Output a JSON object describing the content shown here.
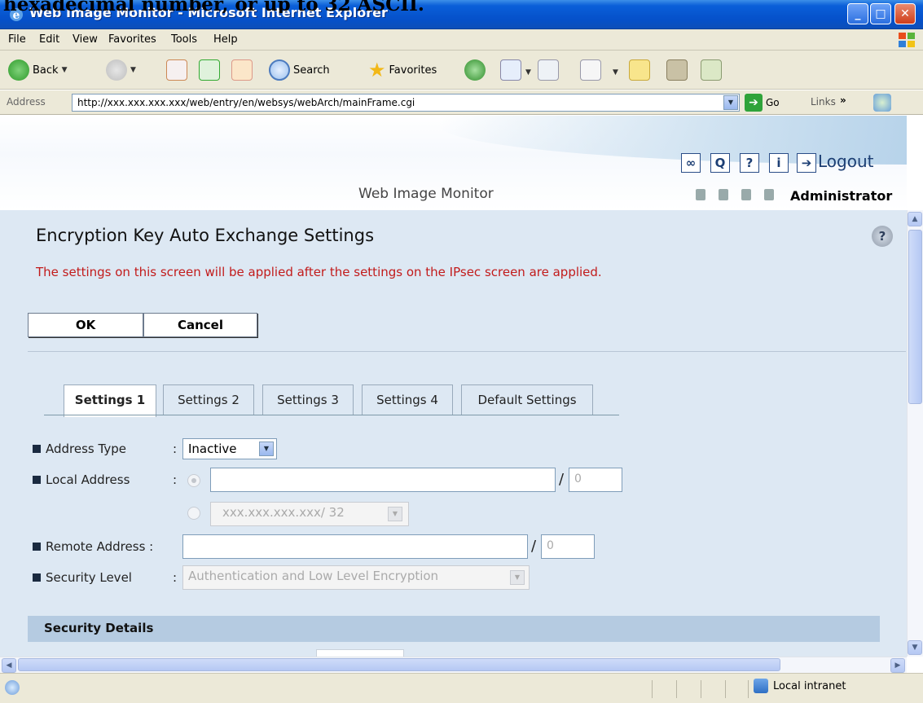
{
  "doc_text": "hexadecimal number, or up to 32 ASCII.",
  "window": {
    "title": "Web Image Monitor - Microsoft Internet Explorer"
  },
  "menu": [
    "File",
    "Edit",
    "View",
    "Favorites",
    "Tools",
    "Help"
  ],
  "toolbar": {
    "back": "Back",
    "search": "Search",
    "favorites": "Favorites"
  },
  "address": {
    "label": "Address",
    "url": "http://xxx.xxx.xxx.xxx/web/entry/en/websys/webArch/mainFrame.cgi",
    "go": "Go",
    "links": "Links"
  },
  "header": {
    "logout": "Logout",
    "product": "Web Image Monitor",
    "user": "Administrator",
    "icons": {
      "link": "link-icon",
      "search": "search-icon",
      "help": "question-icon",
      "info": "info-icon",
      "logout": "logout-arrow-icon"
    }
  },
  "page": {
    "title": "Encryption Key Auto Exchange Settings",
    "notice": "The settings on this screen will be applied after the settings on the IPsec screen are applied.",
    "ok": "OK",
    "cancel": "Cancel",
    "tabs": [
      "Settings 1",
      "Settings 2",
      "Settings 3",
      "Settings 4",
      "Default Settings"
    ],
    "active_tab": "Settings 1"
  },
  "form": {
    "address_type": {
      "label": "Address Type",
      "sep": ":",
      "value": "Inactive"
    },
    "local_address": {
      "label": "Local Address",
      "sep": ":",
      "value": "",
      "prefix": "0",
      "ipv4_option": "xxx.xxx.xxx.xxx/ 32"
    },
    "remote_address": {
      "label": "Remote Address :",
      "value": "",
      "prefix": "0"
    },
    "security_level": {
      "label": "Security Level",
      "sep": ":",
      "value": "Authentication and Low Level Encryption"
    },
    "slash": "/"
  },
  "section": {
    "security_details": "Security Details"
  },
  "status": {
    "zone": "Local intranet"
  }
}
